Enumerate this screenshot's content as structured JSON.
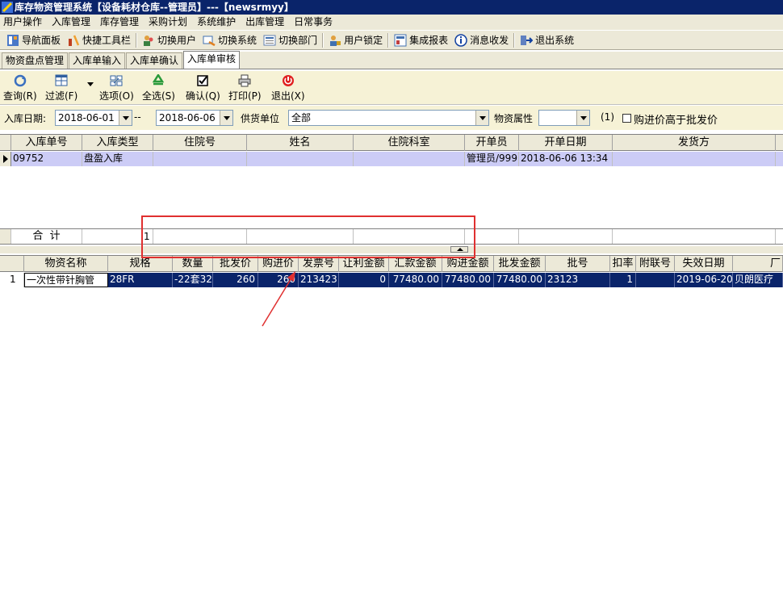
{
  "titlebar": {
    "title": "库存物资管理系统【设备耗材仓库--管理员】---【newsrmyy】"
  },
  "menubar": {
    "items": [
      "用户操作",
      "入库管理",
      "库存管理",
      "采购计划",
      "系统维护",
      "出库管理",
      "日常事务"
    ]
  },
  "toolbar": {
    "nav_panel": "导航面板",
    "quick_toolbar": "快捷工具栏",
    "switch_user": "切换用户",
    "switch_system": "切换系统",
    "switch_dept": "切换部门",
    "user_lock": "用户锁定",
    "integrated_report": "集成报表",
    "messages": "消息收发",
    "exit_system": "退出系统"
  },
  "tabs": [
    "物资盘点管理",
    "入库单输入",
    "入库单确认",
    "入库单审核"
  ],
  "actions": {
    "query": "查询(R)",
    "filter": "过滤(F)",
    "options": "选项(O)",
    "select_all": "全选(S)",
    "confirm": "确认(Q)",
    "print": "打印(P)",
    "exit": "退出(X)"
  },
  "filter": {
    "date_label": "入库日期:",
    "date_from": "2018-06-01",
    "date_sep": "--",
    "date_to": "2018-06-06",
    "supplier_label": "供货单位",
    "supplier_value": "全部",
    "attr_label": "物资属性",
    "attr_value": "",
    "count": "(1)",
    "check_label": "购进价高于批发价"
  },
  "grid1": {
    "columns": [
      "入库单号",
      "入库类型",
      "住院号",
      "姓名",
      "住院科室",
      "开单员",
      "开单日期",
      "发货方"
    ],
    "row": {
      "order_no": "09752",
      "type": "盘盈入库",
      "inpatient_no": "",
      "name": "",
      "dept": "",
      "operator": "管理员/999",
      "date": "2018-06-06 13:34",
      "shipper": ""
    },
    "summary_label": "合  计",
    "summary_count": "1"
  },
  "grid2": {
    "columns": [
      "物资名称",
      "规格",
      "数量",
      "批发价",
      "购进价",
      "发票号",
      "让利金额",
      "汇款金额",
      "购进金额",
      "批发金额",
      "批号",
      "扣率",
      "附联号",
      "失效日期",
      "厂"
    ],
    "row": {
      "row_no": "1",
      "name": "一次性带针胸管",
      "spec": "28FR",
      "qty": "-22套32",
      "wholesale": "260",
      "purchase": "260",
      "invoice": "213423",
      "discount_amt": "0",
      "remit_amt": "77480.00",
      "purchase_amt": "77480.00",
      "wholesale_amt": "77480.00",
      "batch": "23123",
      "rate": "1",
      "attach_no": "",
      "expiry": "2019-06-20",
      "maker": "贝朗医疗"
    }
  },
  "colors": {
    "title_bg": "#0a246a",
    "selected_row": "#0a246a",
    "highlight_row": "#ccccf6",
    "annotation": "#e03030"
  }
}
